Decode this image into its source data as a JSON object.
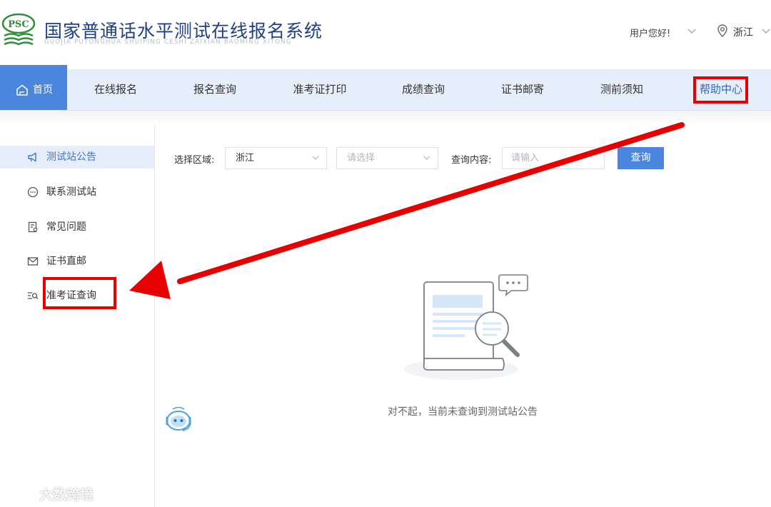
{
  "header": {
    "title": "国家普通话水平测试在线报名系统",
    "subtitle": "GUOJIA PUTONGHUA SHUIPING CESHI ZAIXIAN BAOMING XITONG",
    "logo_text": "PSC",
    "greeting": "用户您好!",
    "location": "浙江"
  },
  "nav": {
    "home": "首页",
    "items": [
      "在线报名",
      "报名查询",
      "准考证打印",
      "成绩查询",
      "证书邮寄",
      "测前须知",
      "帮助中心"
    ]
  },
  "sidebar": {
    "items": [
      {
        "label": "测试站公告",
        "icon": "megaphone-icon"
      },
      {
        "label": "联系测试站",
        "icon": "chat-icon"
      },
      {
        "label": "常见问题",
        "icon": "document-icon"
      },
      {
        "label": "证书直邮",
        "icon": "mail-icon"
      },
      {
        "label": "准考证查询",
        "icon": "search-list-icon"
      }
    ]
  },
  "filters": {
    "region_label": "选择区域:",
    "region_value": "浙江",
    "sub_region_placeholder": "请选择",
    "content_label": "查询内容:",
    "content_placeholder": "请输入",
    "query_button": "查询"
  },
  "empty": {
    "message": "对不起，当前未查询到测试站公告"
  },
  "watermark": "大数跨境",
  "colors": {
    "primary": "#4a86dd",
    "nav_bg": "#e6eefb",
    "annotation_red": "#e60000",
    "title_blue": "#1f3f86",
    "logo_green": "#2f8f3a"
  }
}
